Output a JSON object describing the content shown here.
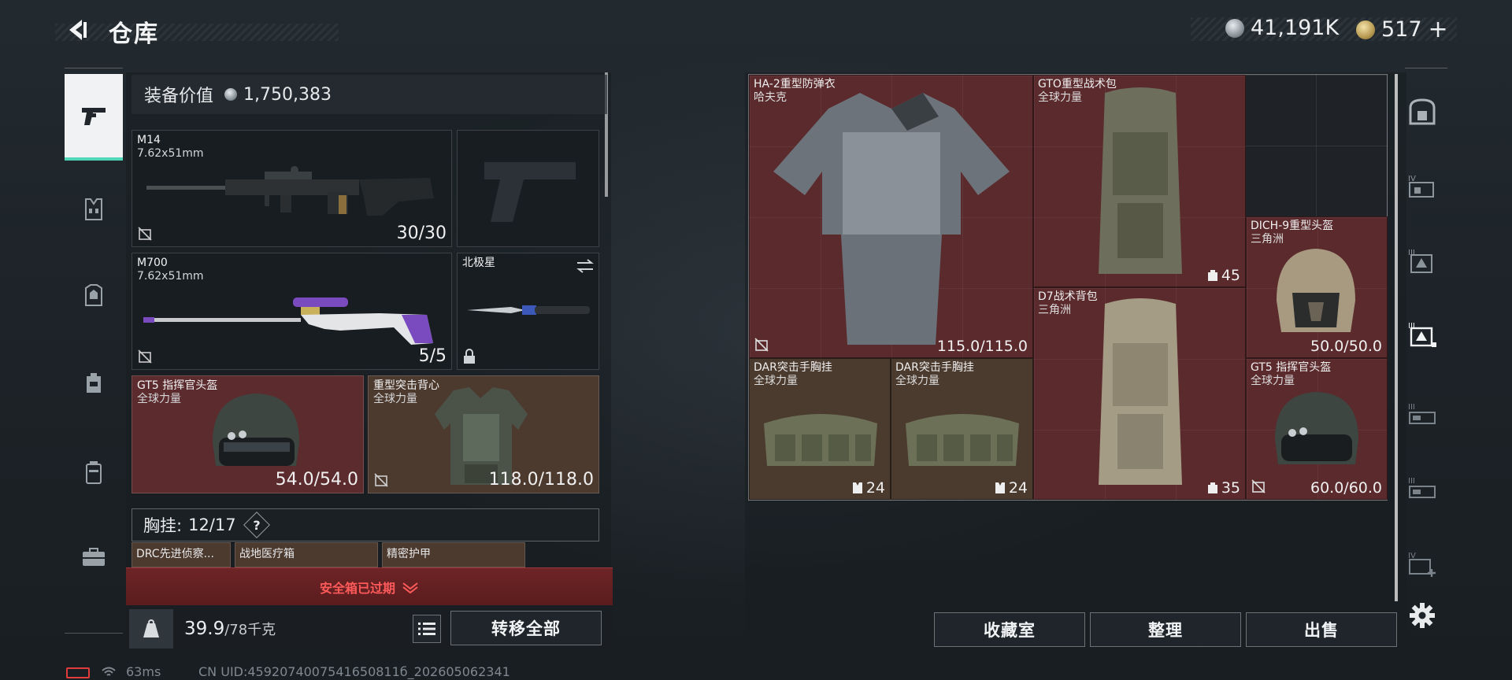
{
  "header": {
    "title": "仓库",
    "silver": "41,191K",
    "gold": "517",
    "gold_plus": "+"
  },
  "equipment": {
    "value_label": "装备价值",
    "value": "1,750,383"
  },
  "slots": {
    "primary": {
      "name": "M14",
      "caliber": "7.62x51mm",
      "ammo": "30/30"
    },
    "secondary": {
      "name": "M700",
      "caliber": "7.62x51mm",
      "ammo": "5/5"
    },
    "melee": {
      "name": "北极星"
    },
    "helmet": {
      "name": "GT5 指挥官头盔",
      "faction": "全球力量",
      "durability": "54.0/54.0"
    },
    "armor": {
      "name": "重型突击背心",
      "faction": "全球力量",
      "durability": "118.0/118.0"
    }
  },
  "chest_rig": {
    "label": "胸挂:",
    "capacity": "12/17",
    "help": "?",
    "items": [
      "DRC先进侦察...",
      "战地医疗箱",
      "精密护甲"
    ]
  },
  "safe_box": {
    "status": "安全箱已过期"
  },
  "bottom": {
    "weight": "39.9",
    "weight_max": "/78千克",
    "transfer_all": "转移全部"
  },
  "stash": {
    "items": [
      {
        "name": "HA-2重型防弹衣",
        "faction": "哈夫克",
        "value": "115.0/115.0"
      },
      {
        "name": "GTO重型战术包",
        "faction": "全球力量",
        "value": "45"
      },
      {
        "name": "DICH-9重型头盔",
        "faction": "三角洲",
        "value": "50.0/50.0"
      },
      {
        "name": "D7战术背包",
        "faction": "三角洲",
        "value": "35"
      },
      {
        "name": "DAR突击手胸挂",
        "faction": "全球力量",
        "value": "24"
      },
      {
        "name": "DAR突击手胸挂",
        "faction": "全球力量",
        "value": "24"
      },
      {
        "name": "GT5 指挥官头盔",
        "faction": "全球力量",
        "value": "60.0/60.0"
      }
    ]
  },
  "actions": {
    "collection": "收藏室",
    "organize": "整理",
    "sell": "出售"
  },
  "status": {
    "ping": "63ms",
    "uid": "CN UID:4592074007541650811б_202605062341"
  },
  "colors": {
    "accent": "#4fd7b7",
    "danger": "#ff5a5a",
    "slot_red": "#5b2a2d",
    "slot_brown": "#4b3a2e"
  }
}
